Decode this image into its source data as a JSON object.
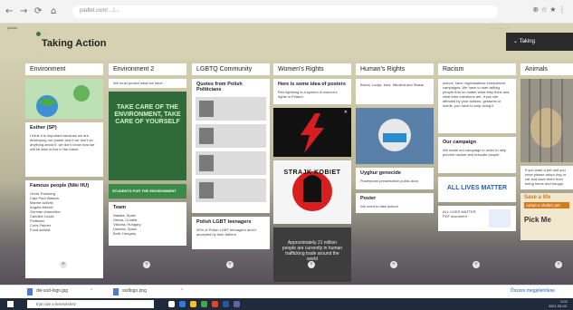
{
  "browser": {
    "url": "padlet.com/…/…",
    "back_icon": "back-arrow-icon",
    "forward_icon": "forward-arrow-icon",
    "reload_icon": "reload-icon"
  },
  "padlet": {
    "brand": "padlet",
    "title": "Taking Action",
    "panel_label": "Taking"
  },
  "columns": [
    {
      "title": "Environment"
    },
    {
      "title": "Environment 2"
    },
    {
      "title": "LGBTQ Community"
    },
    {
      "title": "Women's Rights"
    },
    {
      "title": "Human's Rights"
    },
    {
      "title": "Racism"
    },
    {
      "title": "Animals"
    }
  ],
  "env1": {
    "card_heading": "Esther (SP)",
    "card_text": "I think it is important because we are destroying our planet and if we don't do anything about it, we don't know how we will be able to live in the future",
    "famous_heading": "Famous people (Niki HU)",
    "famous_list": [
      "Greta Thunberg",
      "Capt Paul Watson",
      "Marine activist",
      "Angela Merkel",
      "German chancellor",
      "Candice Lucas",
      "Politician",
      "Curis Palmer",
      "Food activist"
    ]
  },
  "env2": {
    "intro": "We must protect what we have.",
    "poster_text": "TAKE CARE OF THE ENVIRONMENT, TAKE CARE OF YOURSELF",
    "strip_text": "STUDENTS FOR THE ENVIRONMENT",
    "team_heading": "Team",
    "team_list": [
      "Natalia, Spain",
      "Vesna, Croatia",
      "Viktoria, Hungary",
      "Daniela, Spain",
      "Bolti, Hungary"
    ]
  },
  "lgbtq": {
    "quotes_heading": "Quotes from Polish Politicians",
    "teens_heading": "Polish LGBT teenagers",
    "teens_text": "30% of Polish LGBT teenagers aren't accepted by their fathers"
  },
  "women": {
    "intro_heading": "Here is some idea of posters",
    "intro_text": "Red lightning is a symbol of women's rights in Poland",
    "poster_text": "STRAJK KOBIET",
    "trafficking_text": "Approximately 21 million people are currently in human trafficking trade around the world"
  },
  "human": {
    "names_text": "Bruna, Lucija, Irina, Nikolina and Stasia",
    "caption_heading": "Uyghur genocide",
    "caption_text": "Powerpoint presentation public.docs",
    "poster_heading": "Poster",
    "poster_text": "We need to take action!"
  },
  "racism": {
    "intro_text": "school, have organisations everywhere, campaigns. We have to start talking people that no matter what they think and what their intentions are, if you are affected by your actions, gestures or words, you have to stop doing it",
    "campaign_heading": "Our campaign",
    "campaign_text": "We made our campaign in order to help prevent racism and educate people.",
    "poster_text": "ALL LIVES MATTER",
    "small_text": "ALL LIVES MATTER PDF document"
  },
  "animals": {
    "text": "If you want a pet and you have please adopt dog or cat and save them from being home and hungry",
    "poster_text1": "Save a life",
    "poster_text2": "Adopt a shelter pet",
    "poster_text3": "Pick Me"
  },
  "downloads": {
    "file1": "dw-ssd-logo.jpg",
    "file2": "ssdlogo.png",
    "show_all": "Összes megjelenítése"
  },
  "taskbar": {
    "search_placeholder": "Írjon ide a kereséshez",
    "time": "9:02",
    "date": "2021.05.20."
  },
  "colors": {
    "poster_green": "#2f6b3a",
    "lightning_red": "#d81e1e",
    "taskbar": "#1f2a3a"
  }
}
